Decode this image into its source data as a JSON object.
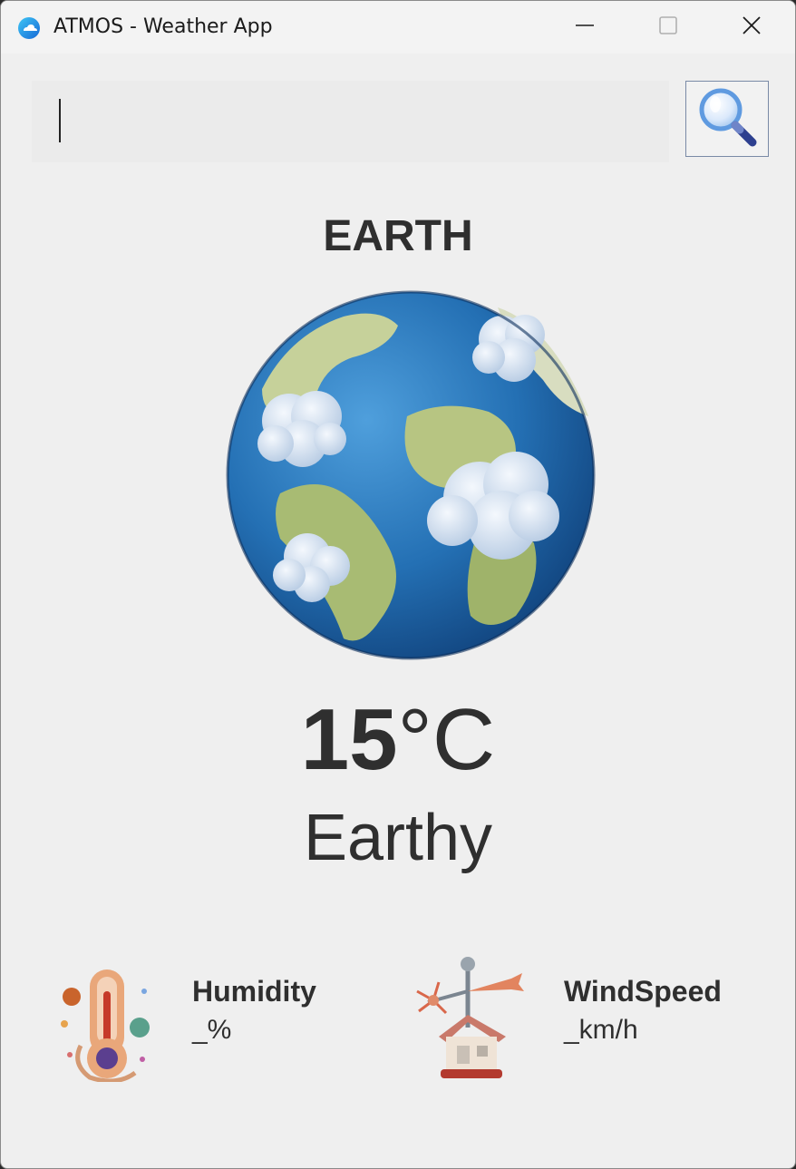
{
  "window": {
    "title": "ATMOS - Weather App",
    "icon": "weather-app-icon",
    "controls": [
      "minimize-icon",
      "maximize-icon",
      "close-icon"
    ]
  },
  "search": {
    "value": "",
    "placeholder": "",
    "button_icon": "search-icon"
  },
  "city": {
    "name": "EARTH",
    "image_icon": "earth-globe-icon"
  },
  "weather": {
    "temperature": "15",
    "unit": "°C",
    "description": "Earthy"
  },
  "stats": {
    "humidity": {
      "label": "Humidity",
      "value": "_%",
      "icon": "thermometer-icon"
    },
    "wind": {
      "label": "WindSpeed",
      "value": "_km/h",
      "icon": "wind-vane-icon"
    }
  },
  "colors": {
    "background": "#efefef",
    "text": "#2f2f2f",
    "accent": "#2f7fe0"
  }
}
